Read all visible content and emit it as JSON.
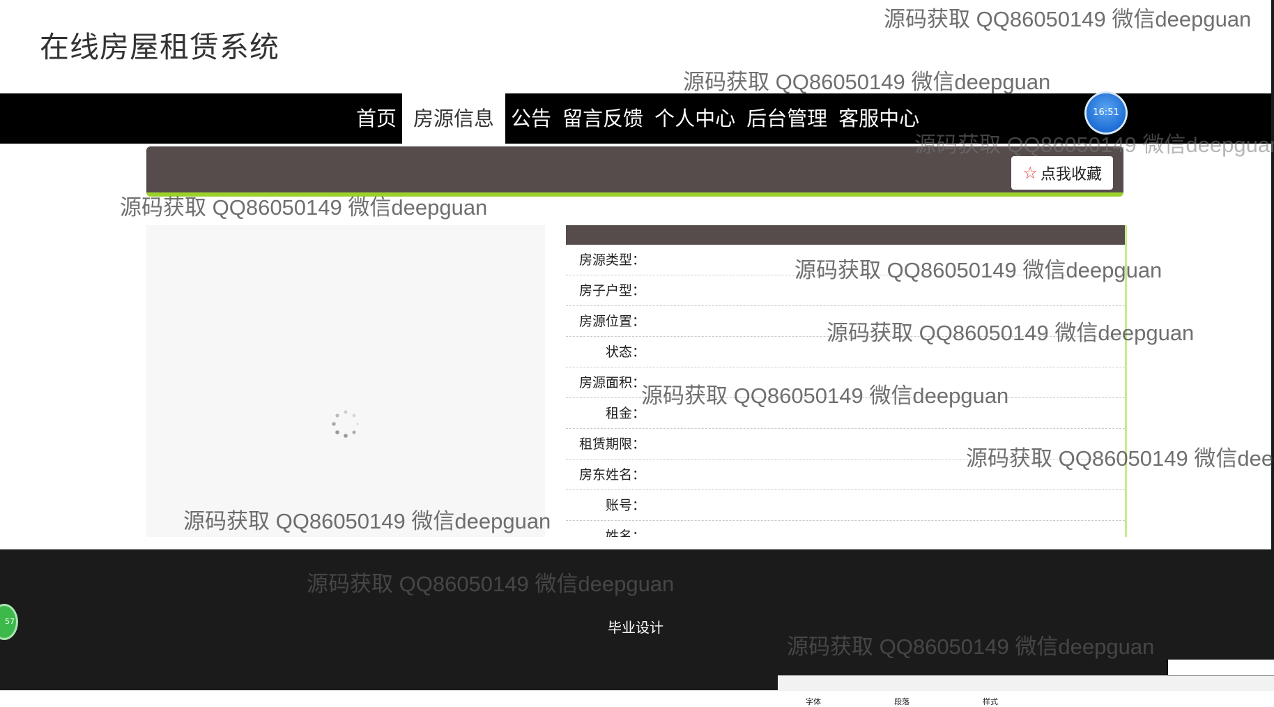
{
  "site": {
    "title": "在线房屋租赁系统"
  },
  "nav": {
    "items": [
      {
        "label": "首页",
        "active": false
      },
      {
        "label": "房源信息",
        "active": true
      },
      {
        "label": "公告",
        "active": false
      },
      {
        "label": "留言反馈",
        "active": false
      },
      {
        "label": "个人中心",
        "active": false
      },
      {
        "label": "后台管理",
        "active": false
      },
      {
        "label": "客服中心",
        "active": false
      }
    ]
  },
  "clock": {
    "time": "16:51"
  },
  "banner": {
    "favorite_label": "点我收藏",
    "favorite_icon": "star-outline-icon"
  },
  "details": {
    "fields": [
      {
        "label": "房源类型：",
        "value": ""
      },
      {
        "label": "房子户型：",
        "value": ""
      },
      {
        "label": "房源位置：",
        "value": ""
      },
      {
        "label": "状态：",
        "value": ""
      },
      {
        "label": "房源面积：",
        "value": ""
      },
      {
        "label": "租金：",
        "value": ""
      },
      {
        "label": "租赁期限：",
        "value": ""
      },
      {
        "label": "房东姓名：",
        "value": ""
      },
      {
        "label": "账号：",
        "value": ""
      },
      {
        "label": "姓名：",
        "value": ""
      }
    ]
  },
  "footer": {
    "text": "毕业设计"
  },
  "side_badge": {
    "text": "57"
  },
  "watermark": {
    "text": "源码获取 QQ86050149 微信deepguan"
  },
  "taskbar": {
    "labels": [
      "字体",
      "段落",
      "样式"
    ]
  },
  "colors": {
    "accent": "#9ad12d",
    "banner": "#564c4c",
    "nav_bg": "#000000",
    "footer_bg": "#1b1b1b",
    "star": "#e23b3b"
  }
}
